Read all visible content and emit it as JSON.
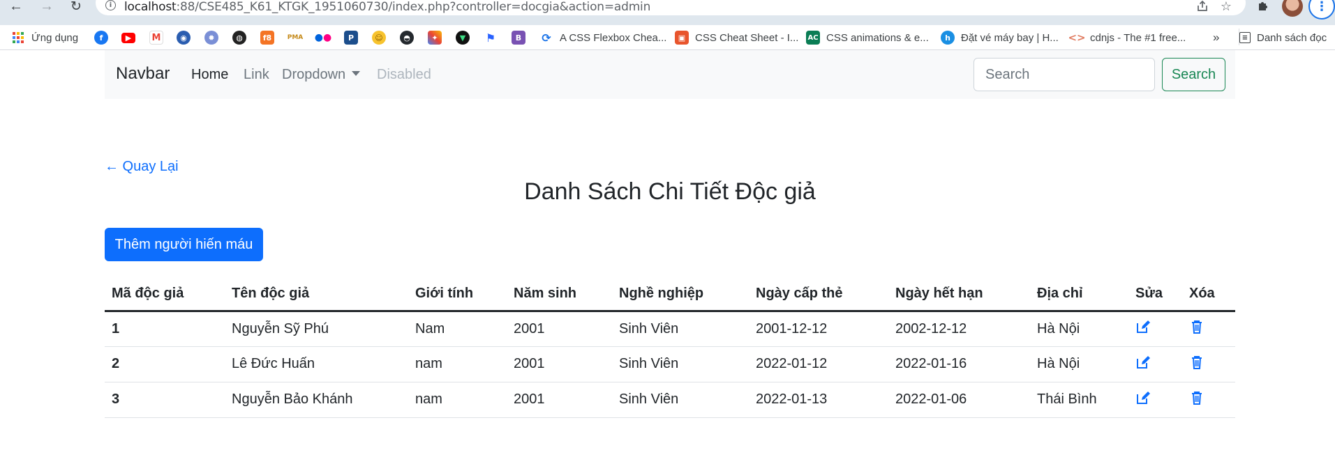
{
  "browser": {
    "url_host": "localhost",
    "url_rest": ":88/CSE485_K61_KTGK_1951060730/index.php?controller=docgia&action=admin",
    "bookmarks": {
      "apps_label": "Ứng dụng",
      "flexbox": "A CSS Flexbox Chea...",
      "cheatsheet": "CSS Cheat Sheet - I...",
      "animations": "CSS animations & e...",
      "flight": "Đặt vé máy bay | H...",
      "cdnjs": "cdnjs - The #1 free...",
      "more": "»",
      "reading_list": "Danh sách đọc"
    }
  },
  "navbar": {
    "brand": "Navbar",
    "home": "Home",
    "link": "Link",
    "dropdown": "Dropdown",
    "disabled": "Disabled",
    "search_placeholder": "Search",
    "search_button": "Search"
  },
  "page": {
    "back_link": "← Quay Lại",
    "title": "Danh Sách Chi Tiết Độc giả",
    "add_button": "Thêm người hiến máu"
  },
  "table": {
    "headers": [
      "Mã độc giả",
      "Tên độc giả",
      "Giới tính",
      "Năm sinh",
      "Nghề nghiệp",
      "Ngày cấp thẻ",
      "Ngày hết hạn",
      "Địa chỉ",
      "Sửa",
      "Xóa"
    ],
    "rows": [
      {
        "id": "1",
        "name": "Nguyễn Sỹ Phú",
        "gender": "Nam",
        "birth_year": "2001",
        "job": "Sinh Viên",
        "issue_date": "2001-12-12",
        "expiry_date": "2002-12-12",
        "address": "Hà Nội"
      },
      {
        "id": "2",
        "name": "Lê Đức Huấn",
        "gender": "nam",
        "birth_year": "2001",
        "job": "Sinh Viên",
        "issue_date": "2022-01-12",
        "expiry_date": "2022-01-16",
        "address": "Hà Nội"
      },
      {
        "id": "3",
        "name": "Nguyễn Bảo Khánh",
        "gender": "nam",
        "birth_year": "2001",
        "job": "Sinh Viên",
        "issue_date": "2022-01-13",
        "expiry_date": "2022-01-06",
        "address": "Thái Bình"
      }
    ],
    "edit_icon": "edit-icon",
    "delete_icon": "trash-icon"
  },
  "colors": {
    "primary": "#0d6efd",
    "success": "#198754",
    "navbar_bg": "#f8f9fa"
  }
}
